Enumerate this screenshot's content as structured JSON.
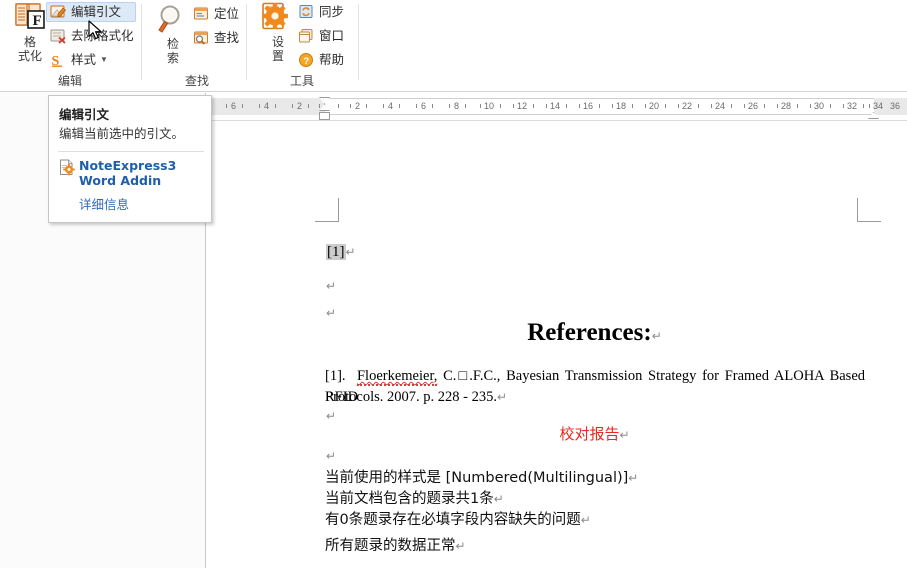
{
  "ribbon": {
    "groups": [
      {
        "name": "format",
        "label": "编辑",
        "big_button": {
          "label_line1": "格",
          "label_line2": "式化",
          "icon": "book-f-icon"
        },
        "small_buttons": [
          {
            "label": "编辑引文",
            "icon": "edit-citation-icon",
            "hovered": true,
            "has_caret": false
          },
          {
            "label": "去除格式化",
            "icon": "remove-format-icon",
            "hovered": false,
            "has_caret": false
          },
          {
            "label": "样式",
            "icon": "style-s-icon",
            "hovered": false,
            "has_caret": true
          }
        ]
      },
      {
        "name": "find",
        "label": "查找",
        "big_button": {
          "label_line1": "检",
          "label_line2": "索",
          "icon": "magnifier-icon"
        },
        "small_buttons": [
          {
            "label": "定位",
            "icon": "locate-icon",
            "hovered": false,
            "has_caret": false
          },
          {
            "label": "查找",
            "icon": "find-icon",
            "hovered": false,
            "has_caret": false
          }
        ]
      },
      {
        "name": "tools",
        "label": "工具",
        "big_button": {
          "label_line1": "设",
          "label_line2": "置",
          "icon": "gear-settings-icon"
        },
        "small_buttons": [
          {
            "label": "同步",
            "icon": "sync-icon",
            "hovered": false,
            "has_caret": false
          },
          {
            "label": "窗口",
            "icon": "window-icon",
            "hovered": false,
            "has_caret": false
          },
          {
            "label": "帮助",
            "icon": "help-icon",
            "hovered": false,
            "has_caret": false
          }
        ]
      }
    ]
  },
  "tooltip": {
    "title": "编辑引文",
    "description": "编辑当前选中的引文。",
    "addin_name": "NoteExpress3 Word Addin",
    "more_link": "详细信息",
    "addin_icon": "document-gear-icon"
  },
  "ruler": {
    "left_ticks": [
      "6",
      "4",
      "2"
    ],
    "right_ticks": [
      "2",
      "4",
      "6",
      "8",
      "10",
      "12",
      "14",
      "16",
      "18",
      "20",
      "22",
      "24",
      "26",
      "28",
      "30",
      "32",
      "34",
      "36"
    ]
  },
  "document": {
    "citation": "[1]",
    "heading": "References:",
    "reference_prefix": "[1].",
    "reference_author": "Floerkemeier,",
    "reference_rest": "C.□.F.C., Bayesian Transmission Strategy for Framed ALOHA Based RFID",
    "reference_line2": "Protocols. 2007. p. 228 - 235.",
    "report_title": "校对报告",
    "report_lines": [
      "当前使用的样式是  [Numbered(Multilingual)]",
      "当前文档包含的题录共1条",
      "有0条题录存在必填字段内容缺失的问题",
      "所有题录的数据正常"
    ],
    "pilcrow": "↵"
  },
  "colors": {
    "accent_orange": "#e8821e",
    "hover_blue": "#dce9f7",
    "link_blue": "#2f6cb5",
    "addin_blue": "#1f5fa9",
    "report_red": "#e8291c",
    "field_gray": "#cccccc"
  }
}
